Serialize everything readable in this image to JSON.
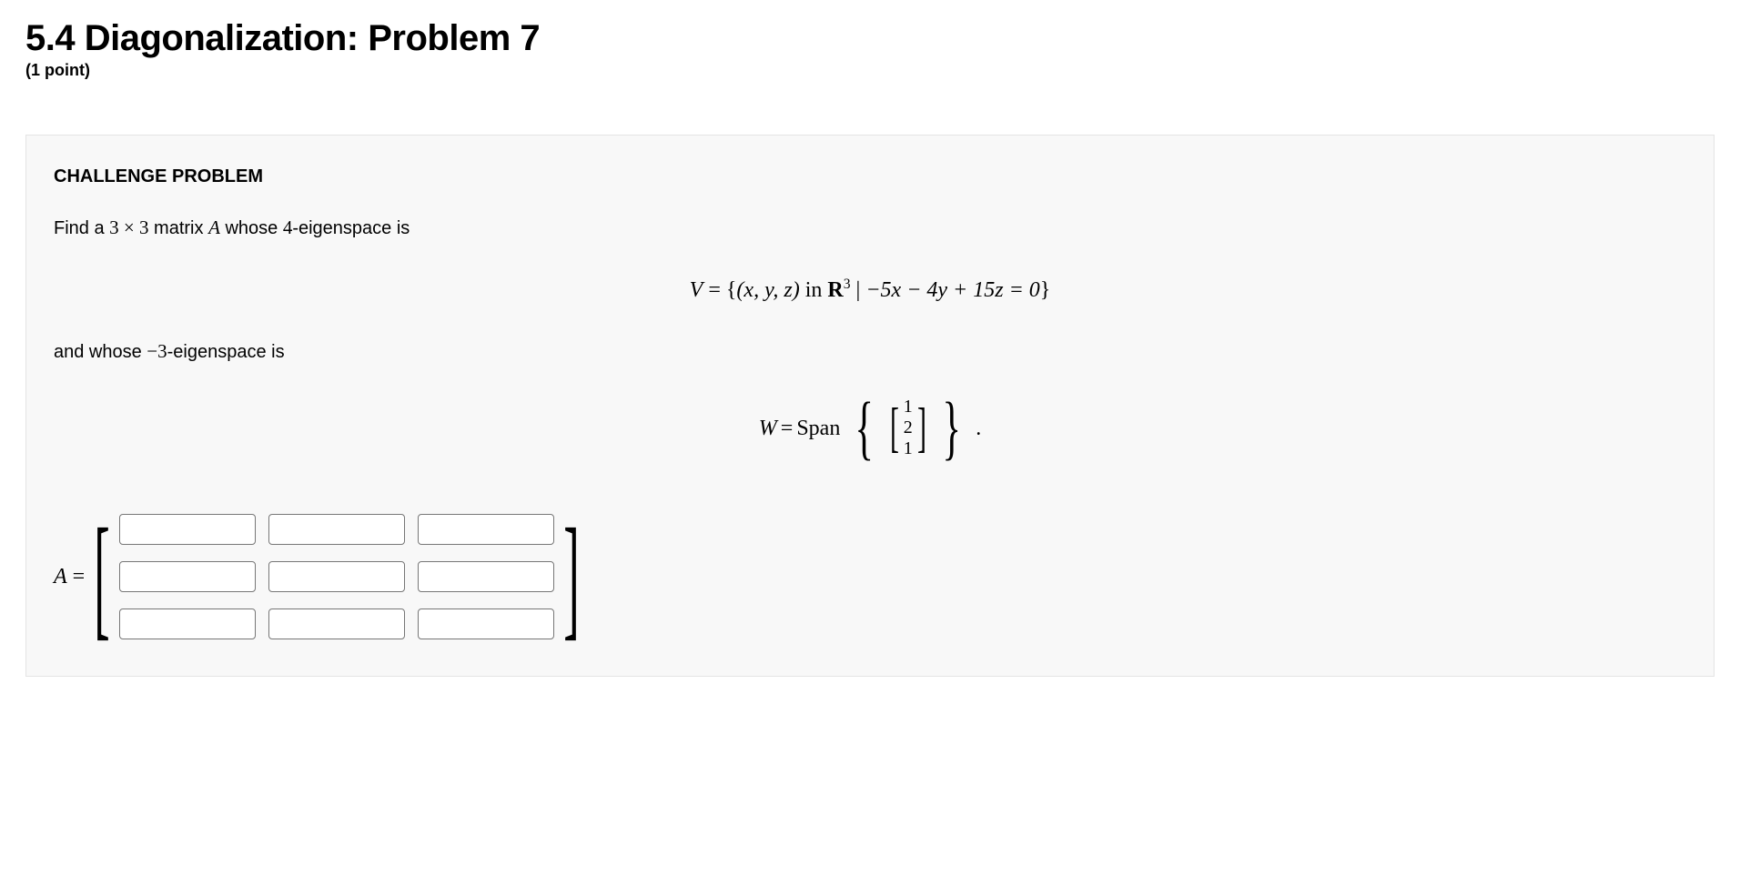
{
  "header": {
    "title": "5.4 Diagonalization: Problem 7",
    "points": "(1 point)"
  },
  "problem": {
    "label": "CHALLENGE PROBLEM",
    "line1_pre": "Find a ",
    "line1_dim": "3 × 3",
    "line1_mid": " matrix ",
    "line1_A": "A",
    "line1_post": " whose ",
    "line1_eig1": "4",
    "line1_tail": "-eigenspace is",
    "eqV_lhs": "V",
    "eqV_eq": " = ",
    "eqV_open": "{",
    "eqV_tuple": "(x, y, z)",
    "eqV_in": " in ",
    "eqV_R": "R",
    "eqV_exp": "3",
    "eqV_bar": " | ",
    "eqV_expr": "−5x − 4y + 15z = 0",
    "eqV_close": "}",
    "line2_pre": "and whose ",
    "line2_eig2": "−3",
    "line2_tail": "-eigenspace is",
    "eqW_lhs": "W",
    "eqW_eq": " = ",
    "eqW_span": "Span",
    "eqW_vec": [
      "1",
      "2",
      "1"
    ],
    "eqW_period": ".",
    "matrix_lhs": "A",
    "matrix_eq": "="
  },
  "answers": {
    "a11": "",
    "a12": "",
    "a13": "",
    "a21": "",
    "a22": "",
    "a23": "",
    "a31": "",
    "a32": "",
    "a33": ""
  }
}
